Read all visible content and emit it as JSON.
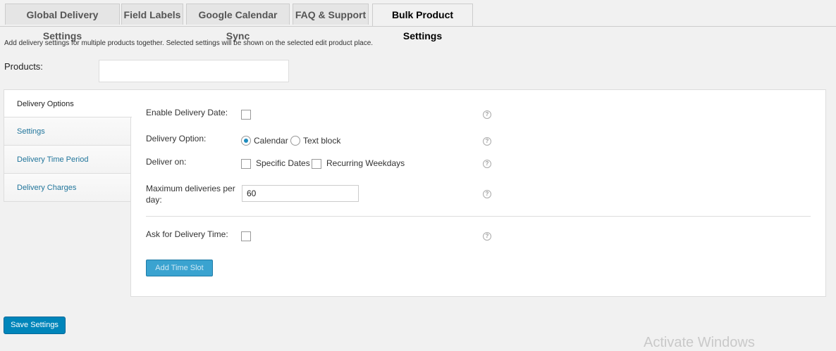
{
  "tabs": [
    "Global Delivery Settings",
    "Field Labels",
    "Google Calendar Sync",
    "FAQ & Support",
    "Bulk Product Settings"
  ],
  "description": "Add delivery settings for multiple products together. Selected settings will be shown on the selected edit product place.",
  "products_label": "Products:",
  "products_value": "",
  "side_tabs": [
    "Delivery Options",
    "Settings",
    "Delivery Time Period",
    "Delivery Charges"
  ],
  "fields": {
    "enable_delivery_date": {
      "label": "Enable Delivery Date:",
      "checked": false
    },
    "delivery_option": {
      "label": "Delivery Option:",
      "options": [
        "Calendar",
        "Text block"
      ],
      "selected": "Calendar"
    },
    "deliver_on": {
      "label": "Deliver on:",
      "options": [
        "Specific Dates",
        "Recurring Weekdays"
      ]
    },
    "max_deliveries": {
      "label_line1": "Maximum deliveries per",
      "label_line2": "day:",
      "value": "60"
    },
    "ask_delivery_time": {
      "label": "Ask for Delivery Time:",
      "checked": false
    }
  },
  "help_glyph": "?",
  "add_time_slot": "Add Time Slot",
  "save_settings": "Save Settings",
  "watermark": "Activate Windows",
  "colors": {
    "primary_button": "#0085ba",
    "link": "#21759b"
  }
}
